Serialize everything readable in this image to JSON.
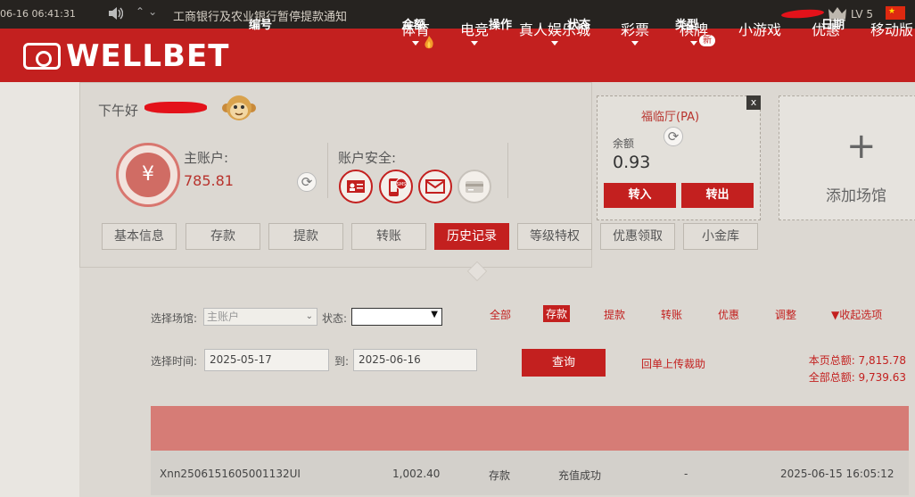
{
  "topbar": {
    "time": "06-16 06:41:31",
    "notice": "工商银行及农业银行暂停提款通知",
    "level": "LV 5",
    "flag": "★"
  },
  "nav": {
    "brand": "WELLBET",
    "items": [
      "体育",
      "电竞",
      "真人娱乐城",
      "彩票",
      "棋牌",
      "小游戏",
      "优惠",
      "移动版"
    ],
    "new_badge": "新"
  },
  "account": {
    "greeting": "下午好",
    "main_label": "主账户:",
    "main_balance": "785.81",
    "security_label": "账户安全:",
    "currency_symbol": "¥",
    "sms": "SMS"
  },
  "tabs": [
    "基本信息",
    "存款",
    "提款",
    "转账",
    "历史记录",
    "等级特权",
    "优惠领取",
    "小金库"
  ],
  "venue": {
    "name": "福临厅(PA)",
    "balance_label": "余额",
    "balance": "0.93",
    "transfer_in": "转入",
    "transfer_out": "转出",
    "close": "x",
    "add_label": "添加场馆",
    "add_symbol": "+"
  },
  "filters": {
    "venue_label": "选择场馆:",
    "venue_value": "主账户",
    "status_label": "状态:",
    "types": [
      "全部",
      "存款",
      "提款",
      "转账",
      "优惠",
      "调整"
    ],
    "collapse": "▼收起选项",
    "time_label": "选择时间:",
    "date_from": "2025-05-17",
    "to_label": "到:",
    "date_to": "2025-06-16",
    "query": "查询",
    "help": "回单上传裁助",
    "page_total": "本页总额: 7,815.78",
    "all_total": "全部总额: 9,739.63"
  },
  "table": {
    "headers": [
      "编号",
      "金额",
      "操作",
      "状态",
      "类型",
      "日期"
    ],
    "rows": [
      [
        "Xnn2506151605001132UI",
        "1,002.40",
        "存款",
        "充值成功",
        "-",
        "2025-06-15 16:05:12"
      ]
    ]
  }
}
